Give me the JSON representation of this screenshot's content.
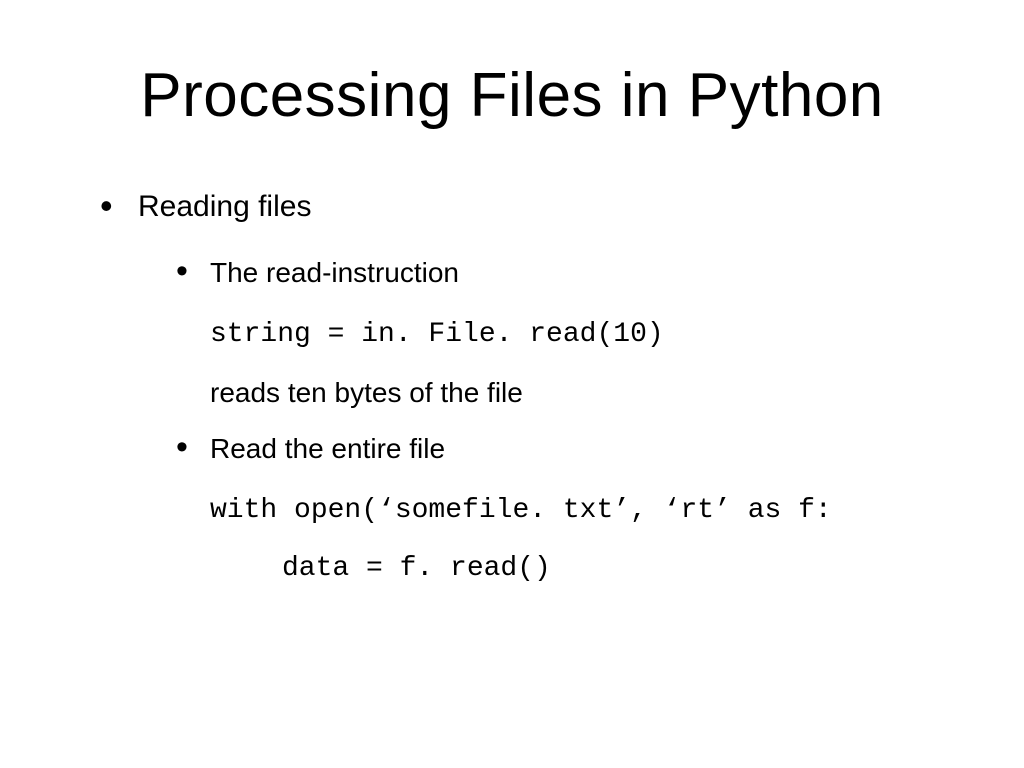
{
  "slide": {
    "title": "Processing Files in Python",
    "bullet1": {
      "label": "Reading files"
    },
    "bullet2a": {
      "label": "The read-instruction",
      "code": "string = in. File. read(10)",
      "desc": "reads ten bytes of the file"
    },
    "bullet2b": {
      "label": "Read the entire file",
      "code1": "with open(‘somefile. txt’, ‘rt’ as f:",
      "code2": "data = f. read()"
    }
  }
}
